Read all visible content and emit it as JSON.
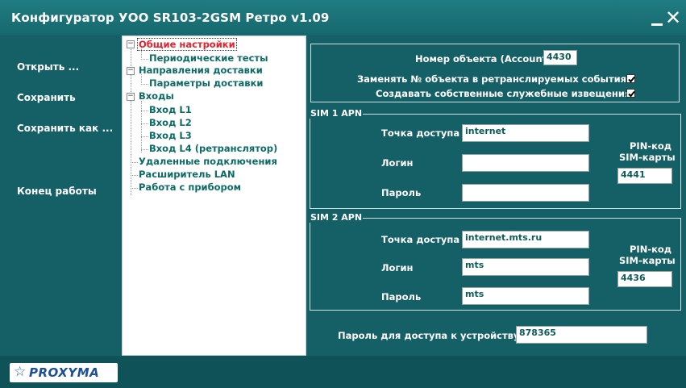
{
  "window": {
    "title": "Конфигуратор УОО SR103-2GSM Ретро v1.09",
    "minimize_icon": "minimize-icon",
    "close_icon": "close-icon",
    "close_glyph": "✕"
  },
  "sidebar": {
    "open_label": "Открыть ...",
    "save_label": "Сохранить",
    "save_as_label": "Сохранить как ...",
    "exit_label": "Конец  работы"
  },
  "tree": {
    "general": "Общие настройки",
    "periodic_tests": "Периодические тесты",
    "delivery_directions": "Направления доставки",
    "delivery_params": "Параметры доставки",
    "inputs": "Входы",
    "input_l1": "Вход L1",
    "input_l2": "Вход L2",
    "input_l3": "Вход L3",
    "input_l4": "Вход L4 (ретранслятор)",
    "remote_connections": "Удаленные подключения",
    "lan_extender": "Расширитель LAN",
    "device_work": "Работа с прибором",
    "collapse_glyph": "−"
  },
  "account": {
    "label": "Номер объекта (Account)",
    "value": "4430",
    "replace_label": "Заменять № объекта в ретранслируемых событиях",
    "replace_checked": true,
    "own_service_label": "Создавать собственные служебные извещения",
    "own_service_checked": true
  },
  "sim1": {
    "legend": "SIM 1 APN",
    "apn_label": "Точка доступа",
    "apn_value": "internet",
    "login_label": "Логин",
    "login_value": "",
    "password_label": "Пароль",
    "password_value": "",
    "pin_label_1": "PIN-код",
    "pin_label_2": "SIM-карты",
    "pin_value": "4441"
  },
  "sim2": {
    "legend": "SIM 2 APN",
    "apn_label": "Точка доступа",
    "apn_value": "internet.mts.ru",
    "login_label": "Логин",
    "login_value": "mts",
    "password_label": "Пароль",
    "password_value": "mts",
    "pin_label_1": "PIN-код",
    "pin_label_2": "SIM-карты",
    "pin_value": "4436"
  },
  "device_password": {
    "label": "Пароль для доступа к устройству:",
    "value": "878365"
  },
  "logo": {
    "text": "PROXYMA",
    "icon": "star-icon",
    "star_glyph": "☆"
  },
  "colors": {
    "background": "#146066",
    "selected_tree_item": "#e8202a",
    "tree_text": "#0d6b66"
  }
}
